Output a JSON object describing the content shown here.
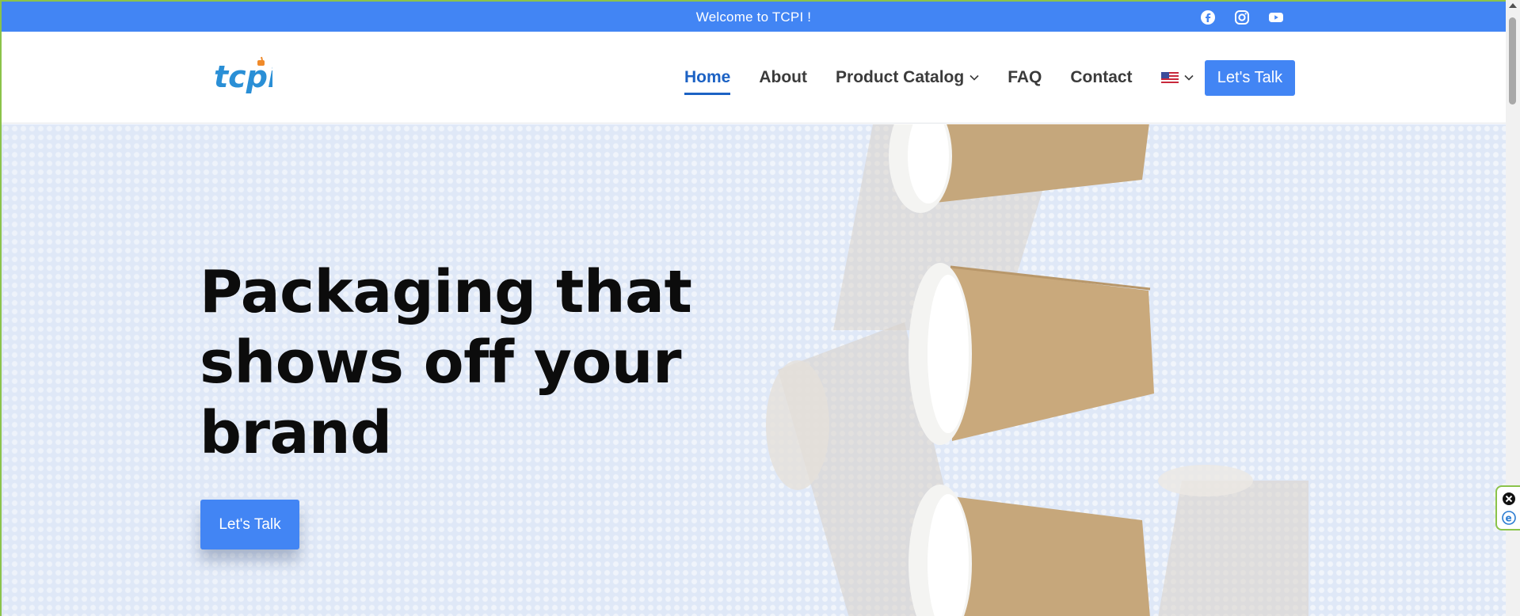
{
  "topbar": {
    "welcome": "Welcome to TCPI !",
    "social_icons": [
      "facebook-icon",
      "instagram-icon",
      "youtube-icon"
    ]
  },
  "header": {
    "logo_text": "tcpi",
    "nav": {
      "home": "Home",
      "about": "About",
      "product_catalog": "Product Catalog",
      "faq": "FAQ",
      "contact": "Contact",
      "language_icon": "us-flag-icon"
    },
    "cta": "Let's Talk"
  },
  "hero": {
    "headline_line1": "Packaging that",
    "headline_line2": "shows off your",
    "headline_line3": "brand",
    "cta": "Let's Talk"
  },
  "colors": {
    "brand_blue": "#4285f4",
    "active_nav": "#1c62c4",
    "hero_bg": "#dfe8f7"
  }
}
